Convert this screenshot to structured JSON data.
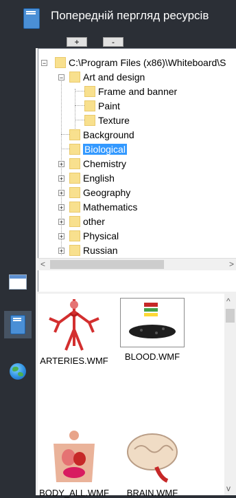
{
  "title": "Попередній пергляд ресурсів",
  "toolbar": {
    "add_label": "+",
    "remove_label": "-"
  },
  "tree": {
    "root": "C:\\Program Files (x86)\\Whiteboard\\S",
    "art": "Art and design",
    "frame": "Frame and banner",
    "paint": "Paint",
    "texture": "Texture",
    "background": "Background",
    "biological": "Biological",
    "chemistry": "Chemistry",
    "english": "English",
    "geography": "Geography",
    "mathematics": "Mathematics",
    "other": "other",
    "physical": "Physical",
    "russian": "Russian"
  },
  "gallery": {
    "items": [
      "ARTERIES.WMF",
      "BLOOD.WMF",
      "BODY_ALL.WMF",
      "BRAIN.WMF"
    ]
  },
  "colors": {
    "selection": "#3399ff",
    "folder": "#f8e08e",
    "sidebar": "#2b2f36"
  }
}
